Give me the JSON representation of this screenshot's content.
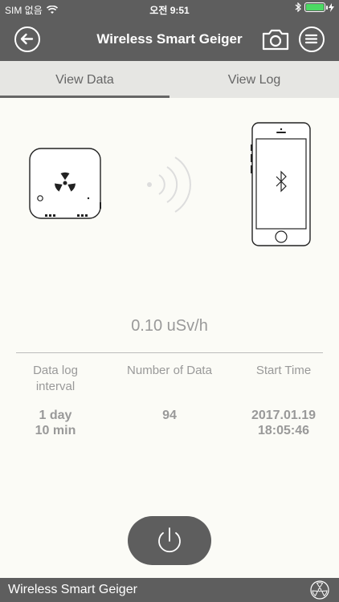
{
  "status_bar": {
    "carrier": "SIM 없음",
    "time": "오전 9:51"
  },
  "nav": {
    "title": "Wireless Smart Geiger",
    "icons": [
      "back-arrow-icon",
      "camera-icon",
      "menu-icon"
    ]
  },
  "tabs": [
    {
      "label": "View Data",
      "active": true
    },
    {
      "label": "View Log",
      "active": false
    }
  ],
  "reading": "0.10 uSv/h",
  "columns": [
    {
      "header": "Data log interval",
      "value_line1": "1 day",
      "value_line2": "10 min"
    },
    {
      "header": "Number of Data",
      "value_line1": "94",
      "value_line2": ""
    },
    {
      "header": "Start Time",
      "value_line1": "2017.01.19",
      "value_line2": "18:05:46"
    }
  ],
  "footer": {
    "label": "Wireless Smart Geiger"
  },
  "colors": {
    "bar": "#5e5e5e",
    "background": "#fbfbf6",
    "battery": "#4cd964"
  }
}
